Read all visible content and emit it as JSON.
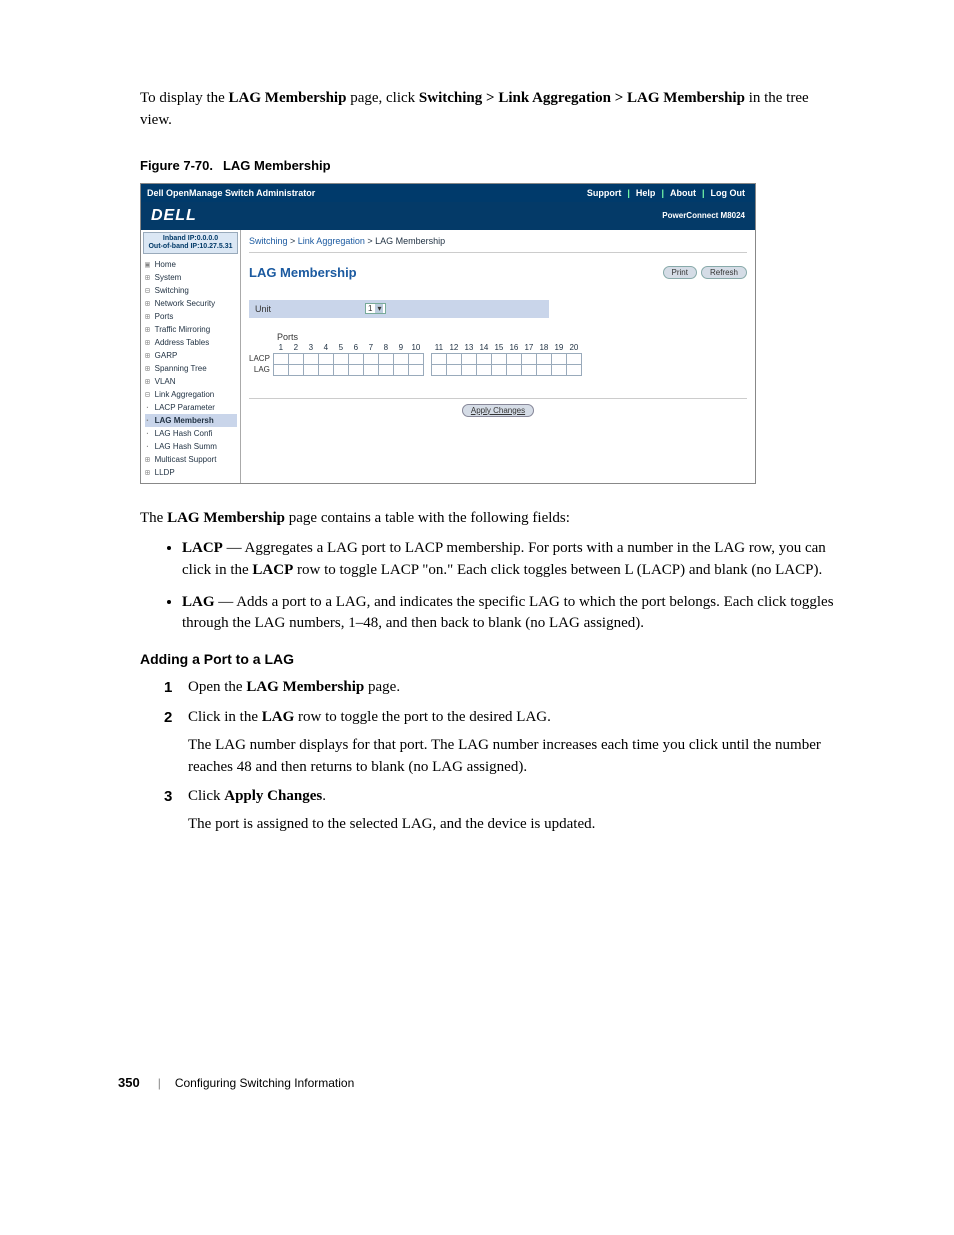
{
  "intro": {
    "pre": "To display the ",
    "bold1": "LAG Membership",
    "mid1": " page, click ",
    "bold2": "Switching > Link Aggregation > LAG Membership",
    "post": " in the tree view."
  },
  "figcaption": {
    "num": "Figure 7-70.",
    "title": "LAG Membership"
  },
  "shot": {
    "topbar": {
      "title": "Dell OpenManage Switch Administrator",
      "links": [
        "Support",
        "Help",
        "About",
        "Log Out"
      ]
    },
    "brand": {
      "logo": "DELL",
      "model": "PowerConnect M8024"
    },
    "ip": {
      "line1": "Inband IP:0.0.0.0",
      "line2": "Out-of-band IP:10.27.5.31"
    },
    "tree": [
      {
        "pre": "▣ ",
        "t": "Home"
      },
      {
        "pre": "⊞ ",
        "t": "System"
      },
      {
        "pre": "⊟ ",
        "t": "Switching"
      },
      {
        "pre": "  ⊞ ",
        "t": "Network Security"
      },
      {
        "pre": "  ⊞ ",
        "t": "Ports"
      },
      {
        "pre": "  ⊞ ",
        "t": "Traffic Mirroring"
      },
      {
        "pre": "  ⊞ ",
        "t": "Address Tables"
      },
      {
        "pre": "  ⊞ ",
        "t": "GARP"
      },
      {
        "pre": "  ⊞ ",
        "t": "Spanning Tree"
      },
      {
        "pre": "  ⊞ ",
        "t": "VLAN"
      },
      {
        "pre": "  ⊟ ",
        "t": "Link Aggregation"
      },
      {
        "pre": "     · ",
        "t": "LACP Parameter"
      },
      {
        "pre": "     · ",
        "t": "LAG Membersh",
        "sel": true
      },
      {
        "pre": "     · ",
        "t": "LAG Hash Confi"
      },
      {
        "pre": "     · ",
        "t": "LAG Hash Summ"
      },
      {
        "pre": "  ⊞ ",
        "t": "Multicast Support"
      },
      {
        "pre": "  ⊞ ",
        "t": "LLDP"
      }
    ],
    "crumb": {
      "a1": "Switching",
      "a2": "Link Aggregation",
      "tail": "LAG Membership"
    },
    "pagetitle": "LAG Membership",
    "btn_print": "Print",
    "btn_refresh": "Refresh",
    "unit": {
      "label": "Unit",
      "value": "1"
    },
    "ports_label": "Ports",
    "port_numbers": [
      "1",
      "2",
      "3",
      "4",
      "5",
      "6",
      "7",
      "8",
      "9",
      "10",
      "11",
      "12",
      "13",
      "14",
      "15",
      "16",
      "17",
      "18",
      "19",
      "20"
    ],
    "row_lacp": "LACP",
    "row_lag": "LAG",
    "apply": "Apply Changes"
  },
  "after": {
    "lead_pre": "The ",
    "lead_b": "LAG Membership",
    "lead_post": " page contains a table with the following fields:",
    "bullets": [
      {
        "b": "LACP",
        "t": " — Aggregates a LAG port to LACP membership. For ports with a number in the LAG row, you can click in the ",
        "b2": "LACP",
        "t2": " row to toggle LACP \"on.\" Each click toggles between L (LACP) and blank (no LACP)."
      },
      {
        "b": "LAG",
        "t": " — Adds a port to a LAG, and indicates the specific LAG to which the port belongs. Each click toggles through the LAG numbers, 1–48, and then back to blank (no LAG assigned)."
      }
    ],
    "heading": "Adding a Port to a LAG",
    "steps": [
      {
        "n": "1",
        "pre": "Open the ",
        "b": "LAG Membership",
        "post": " page."
      },
      {
        "n": "2",
        "pre": "Click in the ",
        "b": "LAG",
        "post": " row to toggle the port to the desired LAG.",
        "sub": "The LAG number displays for that port. The LAG number increases each time you click until the number reaches 48 and then returns to blank (no LAG assigned)."
      },
      {
        "n": "3",
        "pre": "Click ",
        "b": "Apply Changes",
        "post": ".",
        "sub": "The port is assigned to the selected LAG, and the device is updated."
      }
    ]
  },
  "footer": {
    "page": "350",
    "section": "Configuring Switching Information"
  }
}
